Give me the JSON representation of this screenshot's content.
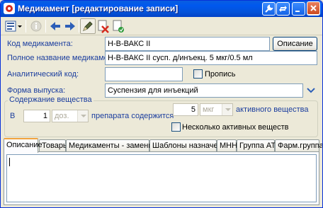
{
  "window": {
    "title": "Медикамент [редактирование записи]",
    "accent": "#0054e3",
    "buttons": [
      "tools-icon",
      "refresh-icon",
      "minimize-icon",
      "maximize-icon",
      "close-icon"
    ]
  },
  "toolbar": {
    "items": [
      "menu-icon",
      "info-icon",
      "back-arrow-icon",
      "forward-arrow-icon",
      "edit-icon",
      "delete-icon",
      "save-icon"
    ]
  },
  "form": {
    "code_label": "Код медикамента:",
    "code_value": "Н-В-ВАКС II",
    "description_button": "Описание",
    "fullname_label": "Полное название медикамента:",
    "fullname_value": "Н-В-ВАКС II сусп. д/инъекц. 5 мкг/0.5 мл",
    "analytic_label": "Аналитический код:",
    "analytic_value": "",
    "propis_label": "Пропись",
    "form_label": "Форма выпуска:",
    "form_value": "Суспензия для инъекций"
  },
  "content": {
    "legend": "Содержание вещества",
    "in_label": "В",
    "qty_value": "1",
    "dose_unit": "доз.",
    "middle_text": "препарата содержится",
    "amount_value": "5",
    "amount_unit": "мкг",
    "active_text": "активного вещества",
    "multi_label": "Несколько активных веществ"
  },
  "tabs": [
    {
      "label": "Описание",
      "active": true
    },
    {
      "label": "Товары"
    },
    {
      "label": "Медикаменты - заменители"
    },
    {
      "label": "Шаблоны назначений"
    },
    {
      "label": "МНН"
    },
    {
      "label": "Группа АТХ"
    },
    {
      "label": "Фарм.группа"
    }
  ]
}
